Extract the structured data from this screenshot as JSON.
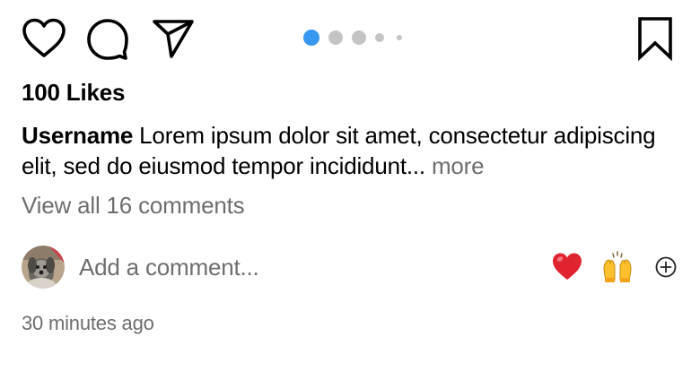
{
  "actions": {
    "like_icon": "heart-outline-icon",
    "comment_icon": "speech-bubble-icon",
    "share_icon": "paper-plane-icon",
    "save_icon": "bookmark-outline-icon"
  },
  "carousel": {
    "total_visible_dots": 5,
    "active_index": 0,
    "active_color": "#3897f0",
    "inactive_color": "#c4c4c4"
  },
  "post": {
    "likes_text": "100 Likes",
    "caption_username": "Username",
    "caption_text": "Lorem ipsum dolor sit amet, consectetur adipiscing elit, sed do eiusmod tempor incididunt...",
    "more_label": "more",
    "view_comments_text": "View all 16 comments",
    "timestamp": "30 minutes ago"
  },
  "comment_bar": {
    "placeholder": "Add a comment...",
    "quick_emojis": [
      "red-heart-emoji",
      "raising-hands-emoji"
    ],
    "add_emoji_icon": "circle-plus-icon"
  },
  "colors": {
    "text_primary": "#000000",
    "text_secondary": "#6e6e6e"
  }
}
